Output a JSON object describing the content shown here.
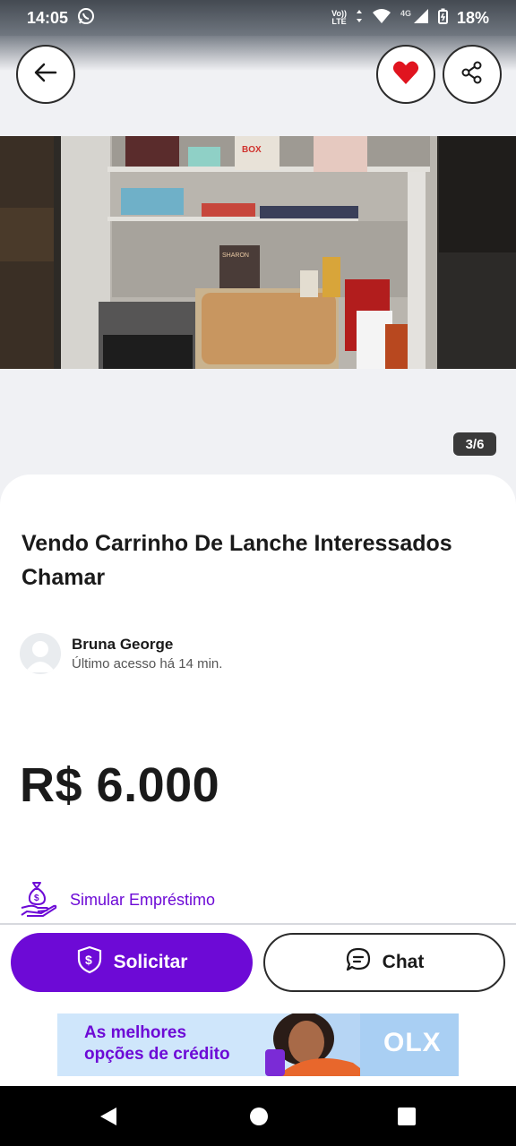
{
  "status_bar": {
    "time": "14:05",
    "network_top": "Vo))",
    "network_bottom": "LTE",
    "signal_label": "4G",
    "battery": "18%",
    "icons": [
      "whatsapp-icon",
      "volte-icon",
      "data-arrows-icon",
      "wifi-icon",
      "signal-icon",
      "battery-icon"
    ]
  },
  "header": {
    "icons": [
      "back-arrow-icon",
      "heart-icon",
      "share-icon"
    ],
    "favorite_color": "#e0141f"
  },
  "gallery": {
    "counter": "3/6",
    "photo_labels": [
      "BOX",
      "SHARON"
    ]
  },
  "listing": {
    "title": "Vendo Carrinho De Lanche Interessados Chamar",
    "seller_name": "Bruna George",
    "seller_status": "Último acesso há 14 min.",
    "price": "R$ 6.000",
    "loan_link": "Simular Empréstimo"
  },
  "actions": {
    "primary_label": "Solicitar",
    "secondary_label": "Chat",
    "primary_color": "#6d0ad6"
  },
  "banner": {
    "text": "As melhores opções de crédito",
    "brand": "OLX"
  }
}
